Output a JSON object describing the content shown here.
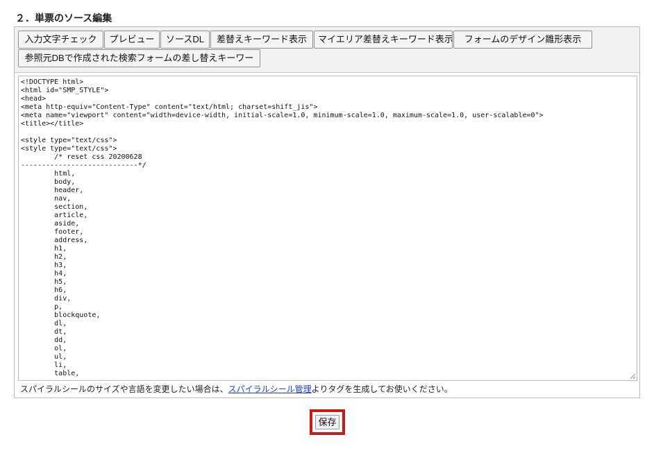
{
  "section": {
    "title": "２．単票のソース編集"
  },
  "toolbar": {
    "buttons": [
      "入力文字チェック",
      "プレビュー",
      "ソースDL",
      "差替えキーワード表示",
      "マイエリア差替えキーワード表示",
      "フォームのデザイン雛形表示",
      "参照元DBで作成された検索フォームの差し替えキーワー"
    ]
  },
  "editor": {
    "source": "<!DOCTYPE html>\n<html id=\"SMP_STYLE\">\n<head>\n<meta http-equiv=\"Content-Type\" content=\"text/html; charset=shift_jis\">\n<meta name=\"viewport\" content=\"width=device-width, initial-scale=1.0, minimum-scale=1.0, maximum-scale=1.0, user-scalable=0\">\n<title></title>\n\n<style type=\"text/css\">\n<style type=\"text/css\">\n        /* reset css 20200628\n----------------------------*/\n        html,\n        body,\n        header,\n        nav,\n        section,\n        article,\n        aside,\n        footer,\n        address,\n        h1,\n        h2,\n        h3,\n        h4,\n        h5,\n        h6,\n        div,\n        p,\n        blockquote,\n        dl,\n        dt,\n        dd,\n        ol,\n        ul,\n        li,\n        table,"
  },
  "help": {
    "before": "スパイラルシールのサイズや言語を変更したい場合は、",
    "link": "スパイラルシール管理",
    "after": "よりタグを生成してお使いください。"
  },
  "actions": {
    "save_label": "保存"
  }
}
